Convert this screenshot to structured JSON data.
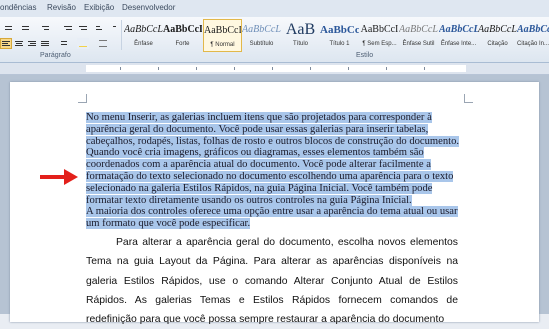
{
  "tabs": [
    "ondências",
    "Revisão",
    "Exibição",
    "Desenvolvedor"
  ],
  "group_labels": {
    "paragraph": "Parágrafo",
    "styles": "Estilo"
  },
  "styles": [
    {
      "sample": "AaBbCcL",
      "name": "Ênfase"
    },
    {
      "sample": "AaBbCcL",
      "name": "Forte"
    },
    {
      "sample": "AaBbCcI",
      "name": "¶ Normal",
      "selected": true
    },
    {
      "sample": "AaBbCcL",
      "name": "Subtítulo"
    },
    {
      "sample": "AaB",
      "name": "Título"
    },
    {
      "sample": "AaBbCc",
      "name": "Título 1"
    },
    {
      "sample": "AaBbCcI",
      "name": "¶ Sem Esp..."
    },
    {
      "sample": "AaBbCcL",
      "name": "Ênfase Sutil"
    },
    {
      "sample": "AaBbCcL",
      "name": "Ênfase Inte..."
    },
    {
      "sample": "AaBbCcL",
      "name": "Citação"
    },
    {
      "sample": "AaBbCcL",
      "name": "Citação In..."
    }
  ],
  "selected_paragraph": [
    "No menu Inserir, as galerias incluem itens que são projetados para corresponder à",
    "aparência geral do documento. Você pode usar essas galerias  para inserir tabelas,",
    "cabeçalhos, rodapés, listas, folhas de rosto e outros blocos de construção do documento.",
    "Quando você cria imagens, gráficos ou diagramas, esses elementos também são",
    "coordenados com a aparência atual do documento. Você pode alterar facilmente a",
    "formatação do texto selecionado no documento escolhendo uma aparência para o texto",
    "selecionado na galeria Estilos Rápidos, na guia Página Inicial.  Você também pode",
    "formatar texto diretamente usando os outros controles na guia Página Inicial.",
    "A maioria dos controles oferece  uma opção entre usar a aparência do tema atual ou usar",
    "um formato que você pode especificar."
  ],
  "body_paragraph": "Para alterar a aparência geral do documento, escolha novos elementos Tema na guia Layout da Página. Para alterar as aparências disponíveis na galeria Estilos Rápidos, use o comando Alterar Conjunto Atual de Estilos Rápidos. As galerias Temas e Estilos Rápidos fornecem comandos de redefinição para que você possa sempre restaurar a aparência do documento"
}
